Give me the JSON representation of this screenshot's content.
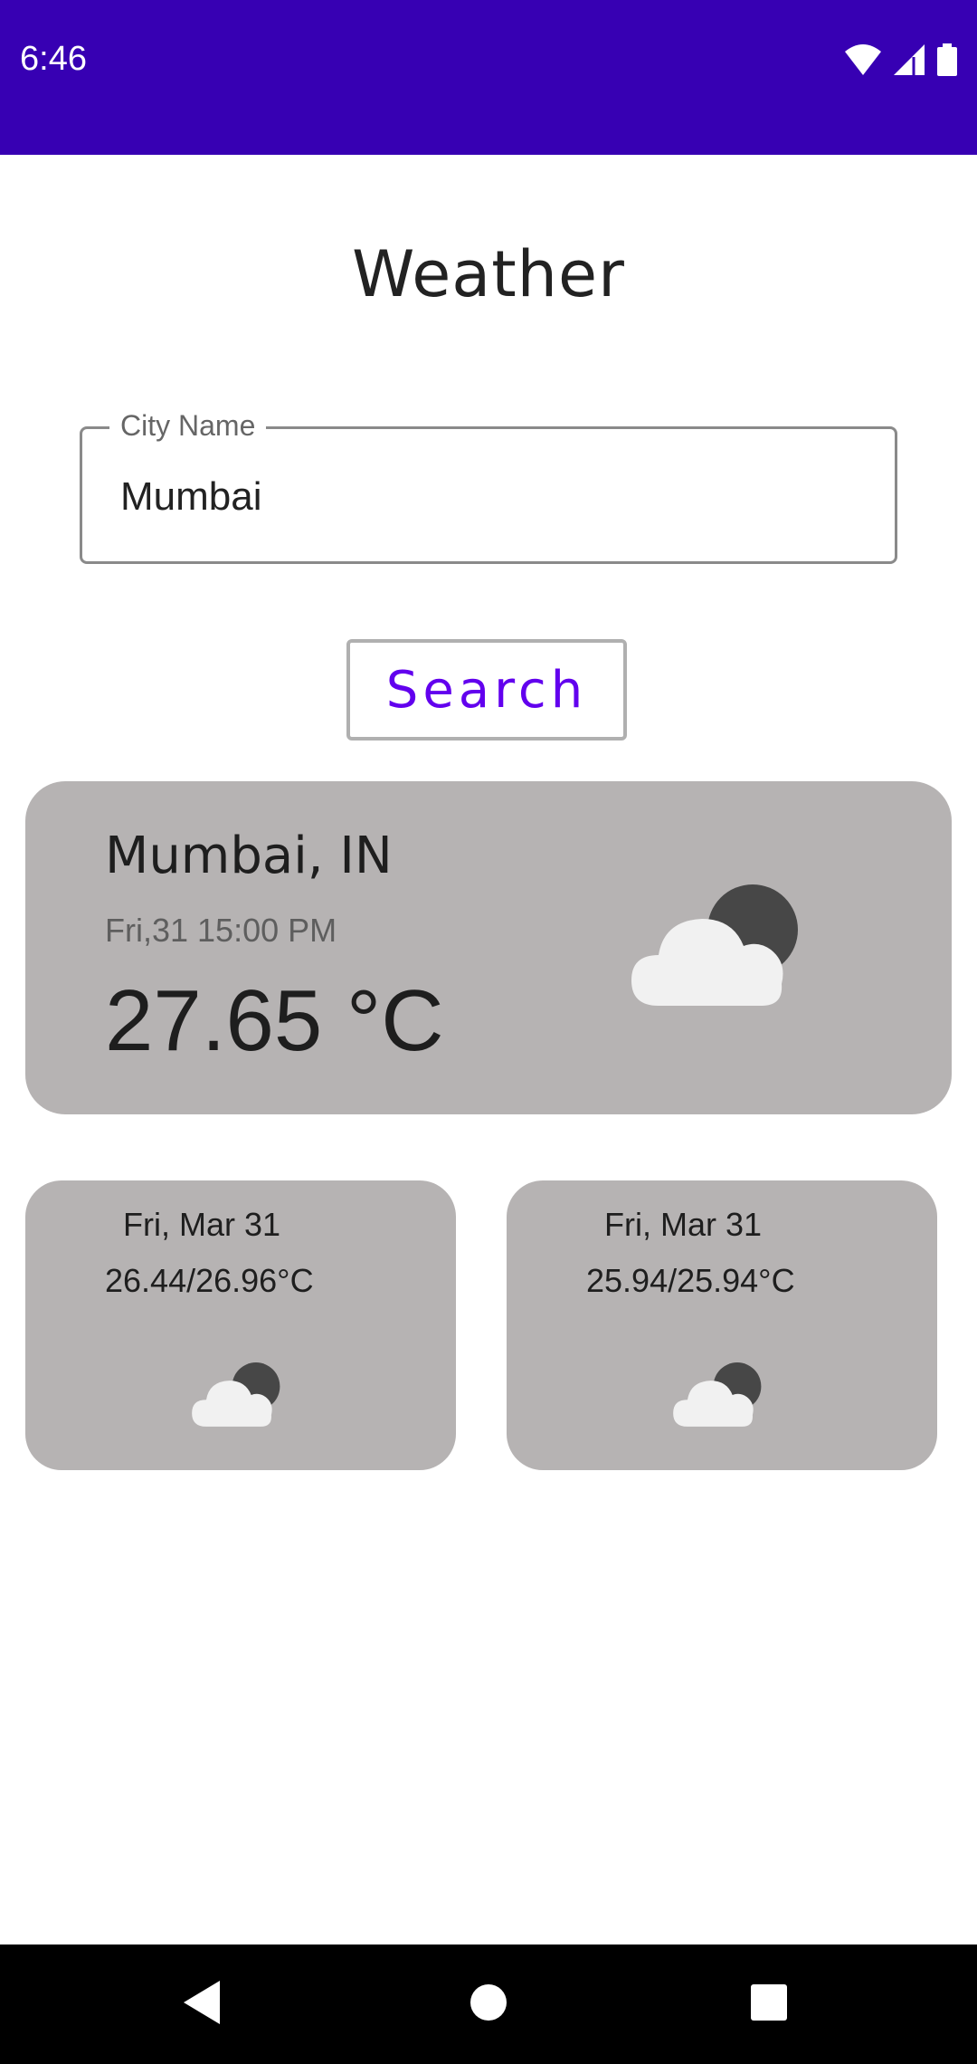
{
  "status_bar": {
    "time": "6:46",
    "background": "#3700b3",
    "icons": [
      "wifi-icon",
      "cell-signal-icon",
      "battery-icon"
    ]
  },
  "app": {
    "title": "Weather"
  },
  "search": {
    "label": "City Name",
    "value": "Mumbai",
    "button_label": "Search",
    "button_color": "#6200ee"
  },
  "current": {
    "city": "Mumbai, IN",
    "datetime": "Fri,31 15:00 PM",
    "temperature": "27.65 °C",
    "icon": "partly-cloudy-night-icon",
    "card_color": "#b6b3b3"
  },
  "forecast": [
    {
      "date": "Fri, Mar 31",
      "range": "26.44/26.96°C",
      "icon": "partly-cloudy-night-icon"
    },
    {
      "date": "Fri, Mar 31",
      "range": "25.94/25.94°C",
      "icon": "partly-cloudy-night-icon"
    }
  ],
  "nav": {
    "icons": [
      "back-icon",
      "home-icon",
      "recents-icon"
    ]
  }
}
